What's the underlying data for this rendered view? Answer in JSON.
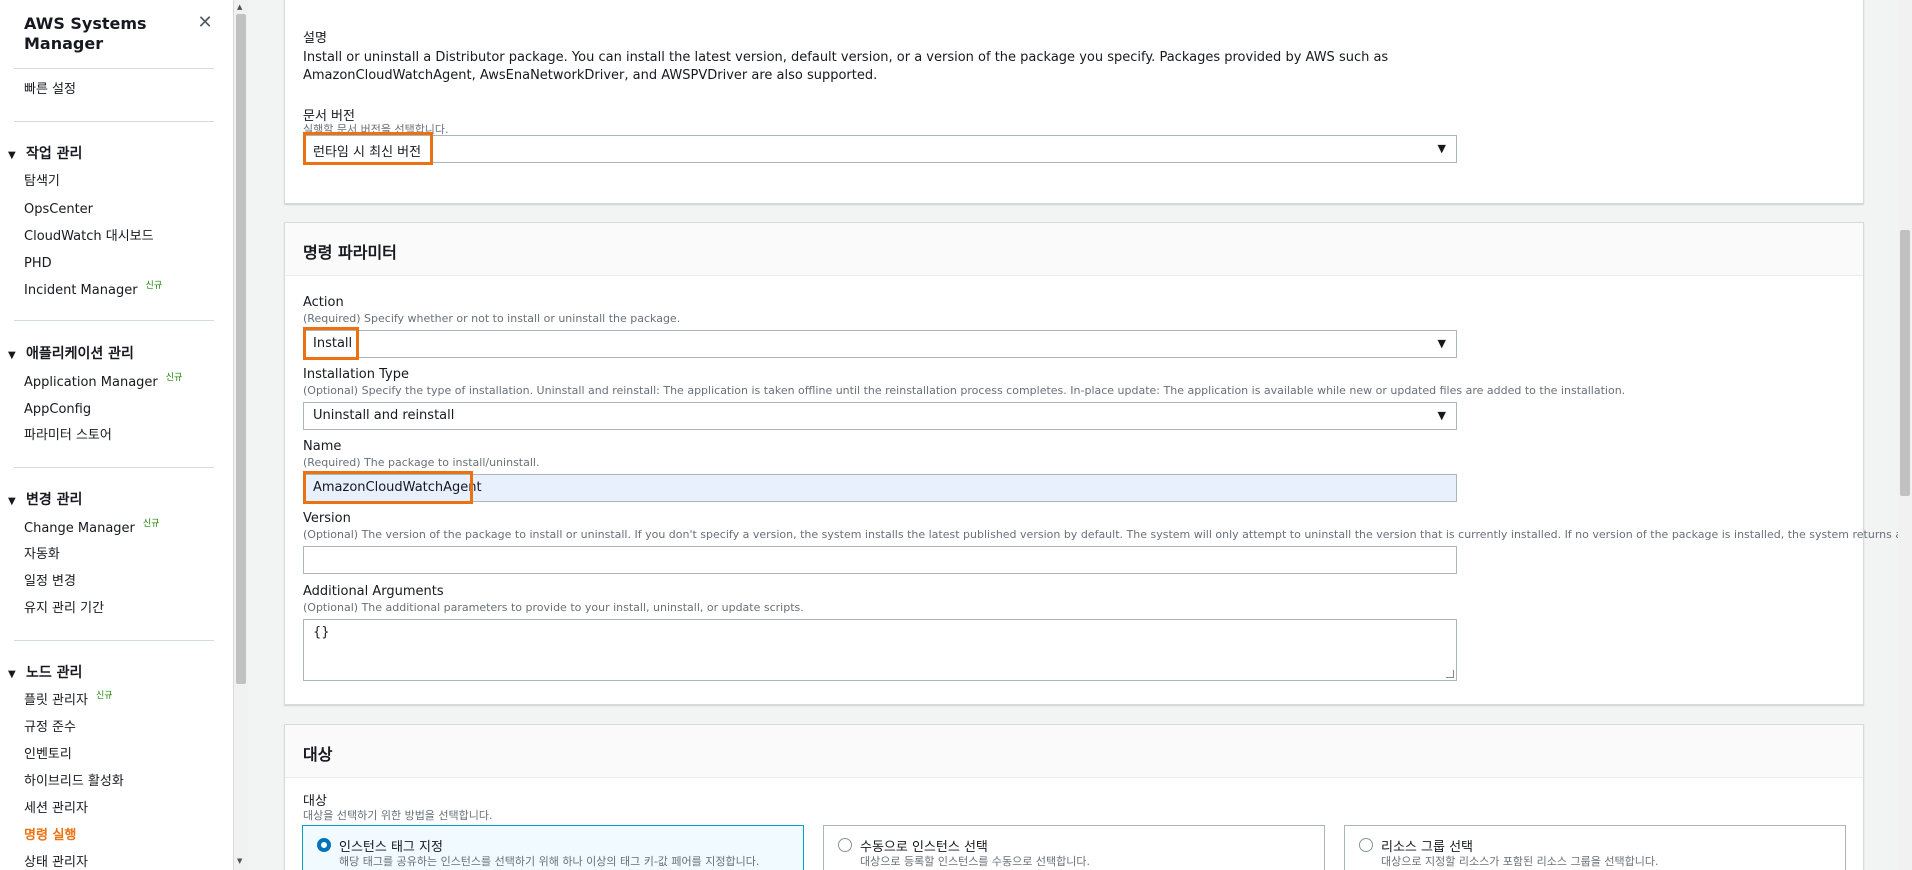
{
  "sidebar": {
    "title": "AWS Systems Manager",
    "quick_setup": "빠른 설정",
    "new_badge": "신규",
    "sections": {
      "operations": "작업 관리",
      "application": "애플리케이션 관리",
      "change": "변경 관리",
      "node": "노드 관리"
    },
    "operations_items": [
      "탐색기",
      "OpsCenter",
      "CloudWatch 대시보드",
      "PHD",
      "Incident Manager"
    ],
    "application_items": [
      "Application Manager",
      "AppConfig",
      "파라미터 스토어"
    ],
    "change_items": [
      "Change Manager",
      "자동화",
      "일정 변경",
      "유지 관리 기간"
    ],
    "node_items": [
      "플릿 관리자",
      "규정 준수",
      "인벤토리",
      "하이브리드 활성화",
      "세션 관리자",
      "명령 실행",
      "상태 관리자"
    ]
  },
  "document": {
    "desc_label": "설명",
    "desc_text": "Install or uninstall a Distributor package. You can install the latest version, default version, or a version of the package you specify. Packages provided by AWS such as AmazonCloudWatchAgent, AwsEnaNetworkDriver, and AWSPVDriver are also supported.",
    "version_label": "문서 버전",
    "version_hint": "실행할 문서 버전을 선택합니다.",
    "version_value": "런타임 시 최신 버전"
  },
  "params": {
    "title": "명령 파라미터",
    "action_label": "Action",
    "action_hint": "(Required) Specify whether or not to install or uninstall the package.",
    "action_value": "Install",
    "install_type_label": "Installation Type",
    "install_type_hint": "(Optional) Specify the type of installation. Uninstall and reinstall: The application is taken offline until the reinstallation process completes. In-place update: The application is available while new or updated files are added to the installation.",
    "install_type_value": "Uninstall and reinstall",
    "name_label": "Name",
    "name_hint": "(Required) The package to install/uninstall.",
    "name_value": "AmazonCloudWatchAgent",
    "version_label": "Version",
    "version_hint": "(Optional) The version of the package to install or uninstall. If you don't specify a version, the system installs the latest published version by default. The system will only attempt to uninstall the version that is currently installed. If no version of the package is installed, the system returns an error.",
    "version_value": "",
    "args_label": "Additional Arguments",
    "args_hint": "(Optional) The additional parameters to provide to your install, uninstall, or update scripts.",
    "args_value": "{}"
  },
  "targets": {
    "title": "대상",
    "label": "대상",
    "hint": "대상을 선택하기 위한 방법을 선택합니다.",
    "options": [
      {
        "title": "인스턴스 태그 지정",
        "desc": "해당 태그를 공유하는 인스턴스를 선택하기 위해 하나 이상의 태그 키-값 페어를 지정합니다."
      },
      {
        "title": "수동으로 인스턴스 선택",
        "desc": "대상으로 등록할 인스턴스를 수동으로 선택합니다."
      },
      {
        "title": "리소스 그룹 선택",
        "desc": "대상으로 지정할 리소스가 포함된 리소스 그룹을 선택합니다."
      }
    ]
  },
  "colors": {
    "highlight": "#ec7211",
    "active_nav": "#ec7211",
    "new_badge": "#1d8102",
    "selected_radio": "#0073bb"
  }
}
